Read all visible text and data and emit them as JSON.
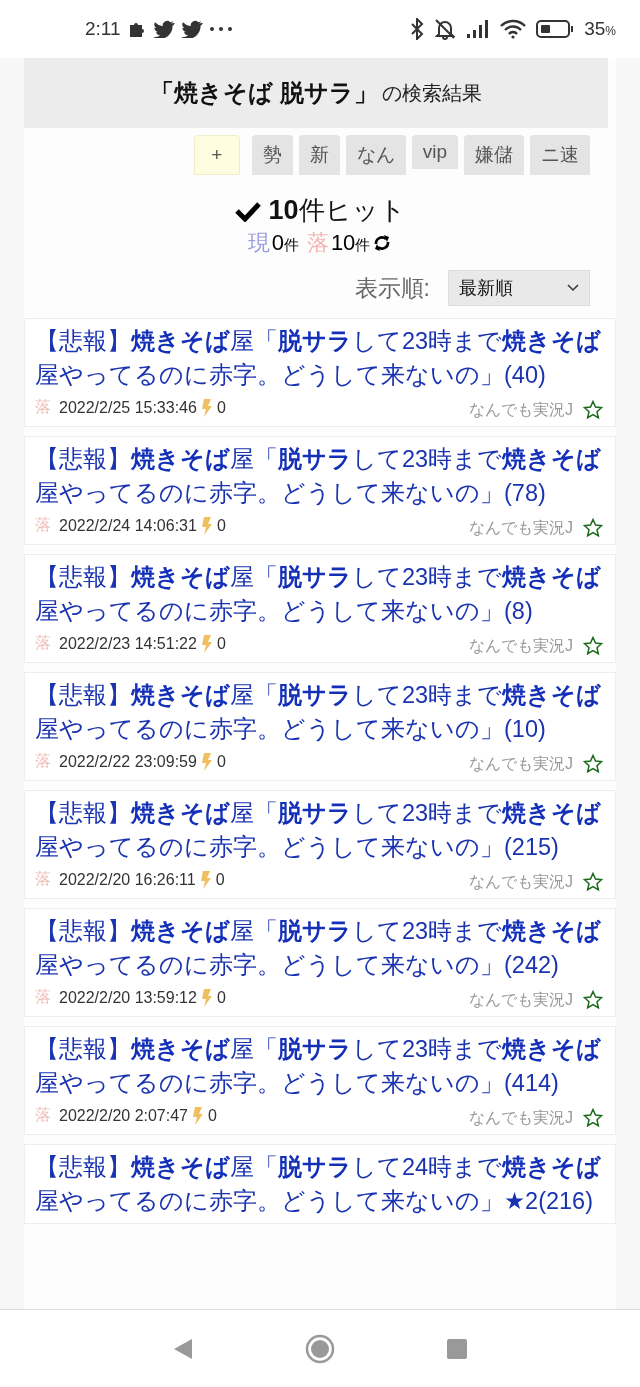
{
  "status_bar": {
    "time": "2:11",
    "battery": "35",
    "battery_unit": "%"
  },
  "header": {
    "query": "「焼きそば 脱サラ」",
    "suffix": "の検索結果"
  },
  "tabs": [
    {
      "label": "+",
      "kind": "add"
    },
    {
      "label": "勢",
      "kind": "board"
    },
    {
      "label": "新",
      "kind": "board"
    },
    {
      "label": "なん",
      "kind": "board"
    },
    {
      "label": "vip",
      "kind": "board"
    },
    {
      "label": "嫌儲",
      "kind": "board"
    },
    {
      "label": "ニ速",
      "kind": "board"
    }
  ],
  "hits": {
    "count": "10",
    "unit": "件ヒット",
    "live_label": "現",
    "live_count": "0",
    "dead_label": "落",
    "live_unit": "件",
    "dead_count": "10",
    "dead_unit": "件"
  },
  "sort": {
    "label": "表示順:",
    "value": "最新順"
  },
  "results": [
    {
      "title": "【悲報】**焼きそば**屋「**脱サラ**して23時まで**焼きそば**屋やってるのに赤字。どうして来ないの」(40)",
      "status": "落",
      "date": "2022/2/25 15:33:46",
      "speed": "0",
      "board": "なんでも実況J"
    },
    {
      "title": "【悲報】**焼きそば**屋「**脱サラ**して23時まで**焼きそば**屋やってるのに赤字。どうして来ないの」(78)",
      "status": "落",
      "date": "2022/2/24 14:06:31",
      "speed": "0",
      "board": "なんでも実況J"
    },
    {
      "title": "【悲報】**焼きそば**屋「**脱サラ**して23時まで**焼きそば**屋やってるのに赤字。どうして来ないの」(8)",
      "status": "落",
      "date": "2022/2/23 14:51:22",
      "speed": "0",
      "board": "なんでも実況J"
    },
    {
      "title": "【悲報】**焼きそば**屋「**脱サラ**して23時まで**焼きそば**屋やってるのに赤字。どうして来ないの」(10)",
      "status": "落",
      "date": "2022/2/22 23:09:59",
      "speed": "0",
      "board": "なんでも実況J"
    },
    {
      "title": "【悲報】**焼きそば**屋「**脱サラ**して23時まで**焼きそば**屋やってるのに赤字。どうして来ないの」(215)",
      "status": "落",
      "date": "2022/2/20 16:26:11",
      "speed": "0",
      "board": "なんでも実況J"
    },
    {
      "title": "【悲報】**焼きそば**屋「**脱サラ**して23時まで**焼きそば**屋やってるのに赤字。どうして来ないの」(242)",
      "status": "落",
      "date": "2022/2/20 13:59:12",
      "speed": "0",
      "board": "なんでも実況J"
    },
    {
      "title": "【悲報】**焼きそば**屋「**脱サラ**して23時まで**焼きそば**屋やってるのに赤字。どうして来ないの」(414)",
      "status": "落",
      "date": "2022/2/20 2:07:47",
      "speed": "0",
      "board": "なんでも実況J"
    },
    {
      "title": "【悲報】**焼きそば**屋「**脱サラ**して24時まで**焼きそば**屋やってるのに赤字。どうして来ないの」★2(216)"
    }
  ]
}
